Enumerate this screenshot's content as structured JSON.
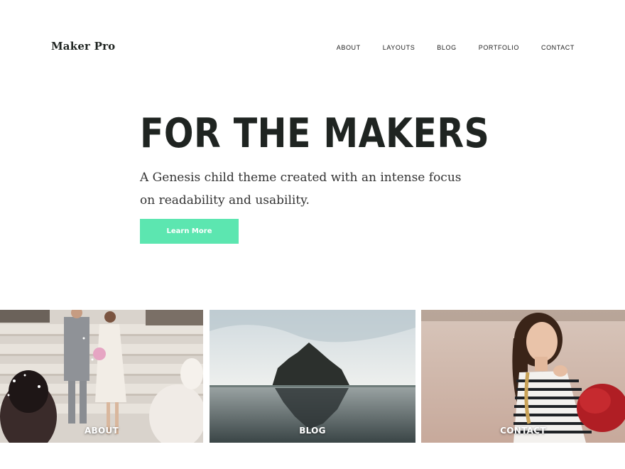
{
  "header": {
    "site_title": "Maker Pro",
    "nav": [
      "ABOUT",
      "LAYOUTS",
      "BLOG",
      "PORTFOLIO",
      "CONTACT"
    ]
  },
  "hero": {
    "title": "FOR THE MAKERS",
    "subtitle": "A Genesis child theme created with an intense focus on readability and usability.",
    "button_label": "Learn More"
  },
  "tiles": [
    {
      "label": "ABOUT"
    },
    {
      "label": "BLOG"
    },
    {
      "label": "CONTACT"
    }
  ],
  "colors": {
    "accent": "#5ce6b0",
    "text": "#1f2421"
  }
}
